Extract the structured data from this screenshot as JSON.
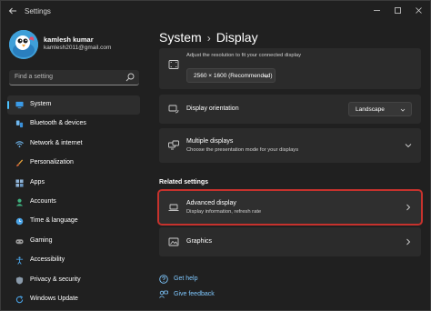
{
  "window": {
    "app_title": "Settings",
    "back_glyph": "←",
    "minimize_glyph": "—",
    "maximize_glyph": "☐",
    "close_glyph": "✕"
  },
  "profile": {
    "name": "kamlesh kumar",
    "email": "kamlesh2011@gmail.com"
  },
  "search": {
    "placeholder": "Find a setting"
  },
  "sidebar": {
    "items": [
      {
        "label": "System",
        "icon": "monitor-icon",
        "active": true
      },
      {
        "label": "Bluetooth & devices",
        "icon": "bluetooth-icon"
      },
      {
        "label": "Network & internet",
        "icon": "wifi-icon"
      },
      {
        "label": "Personalization",
        "icon": "brush-icon"
      },
      {
        "label": "Apps",
        "icon": "apps-icon"
      },
      {
        "label": "Accounts",
        "icon": "person-icon"
      },
      {
        "label": "Time & language",
        "icon": "globe-clock-icon"
      },
      {
        "label": "Gaming",
        "icon": "gamepad-icon"
      },
      {
        "label": "Accessibility",
        "icon": "accessibility-icon"
      },
      {
        "label": "Privacy & security",
        "icon": "shield-icon"
      },
      {
        "label": "Windows Update",
        "icon": "update-icon"
      }
    ]
  },
  "breadcrumb": {
    "parent": "System",
    "separator": "›",
    "current": "Display"
  },
  "cards": {
    "resolution": {
      "subtitle": "Adjust the resolution to fit your connected display",
      "value": "2560 × 1600 (Recommended)"
    },
    "orientation": {
      "title": "Display orientation",
      "value": "Landscape"
    },
    "multiple": {
      "title": "Multiple displays",
      "subtitle": "Choose the presentation mode for your displays"
    },
    "advanced": {
      "title": "Advanced display",
      "subtitle": "Display information, refresh rate"
    },
    "graphics": {
      "title": "Graphics"
    }
  },
  "related_settings_title": "Related settings",
  "links": {
    "help": "Get help",
    "feedback": "Give feedback"
  },
  "colors": {
    "accent": "#4cc2ff",
    "highlight_border": "#c6322d",
    "background": "#202020",
    "card": "#2b2b2b"
  }
}
